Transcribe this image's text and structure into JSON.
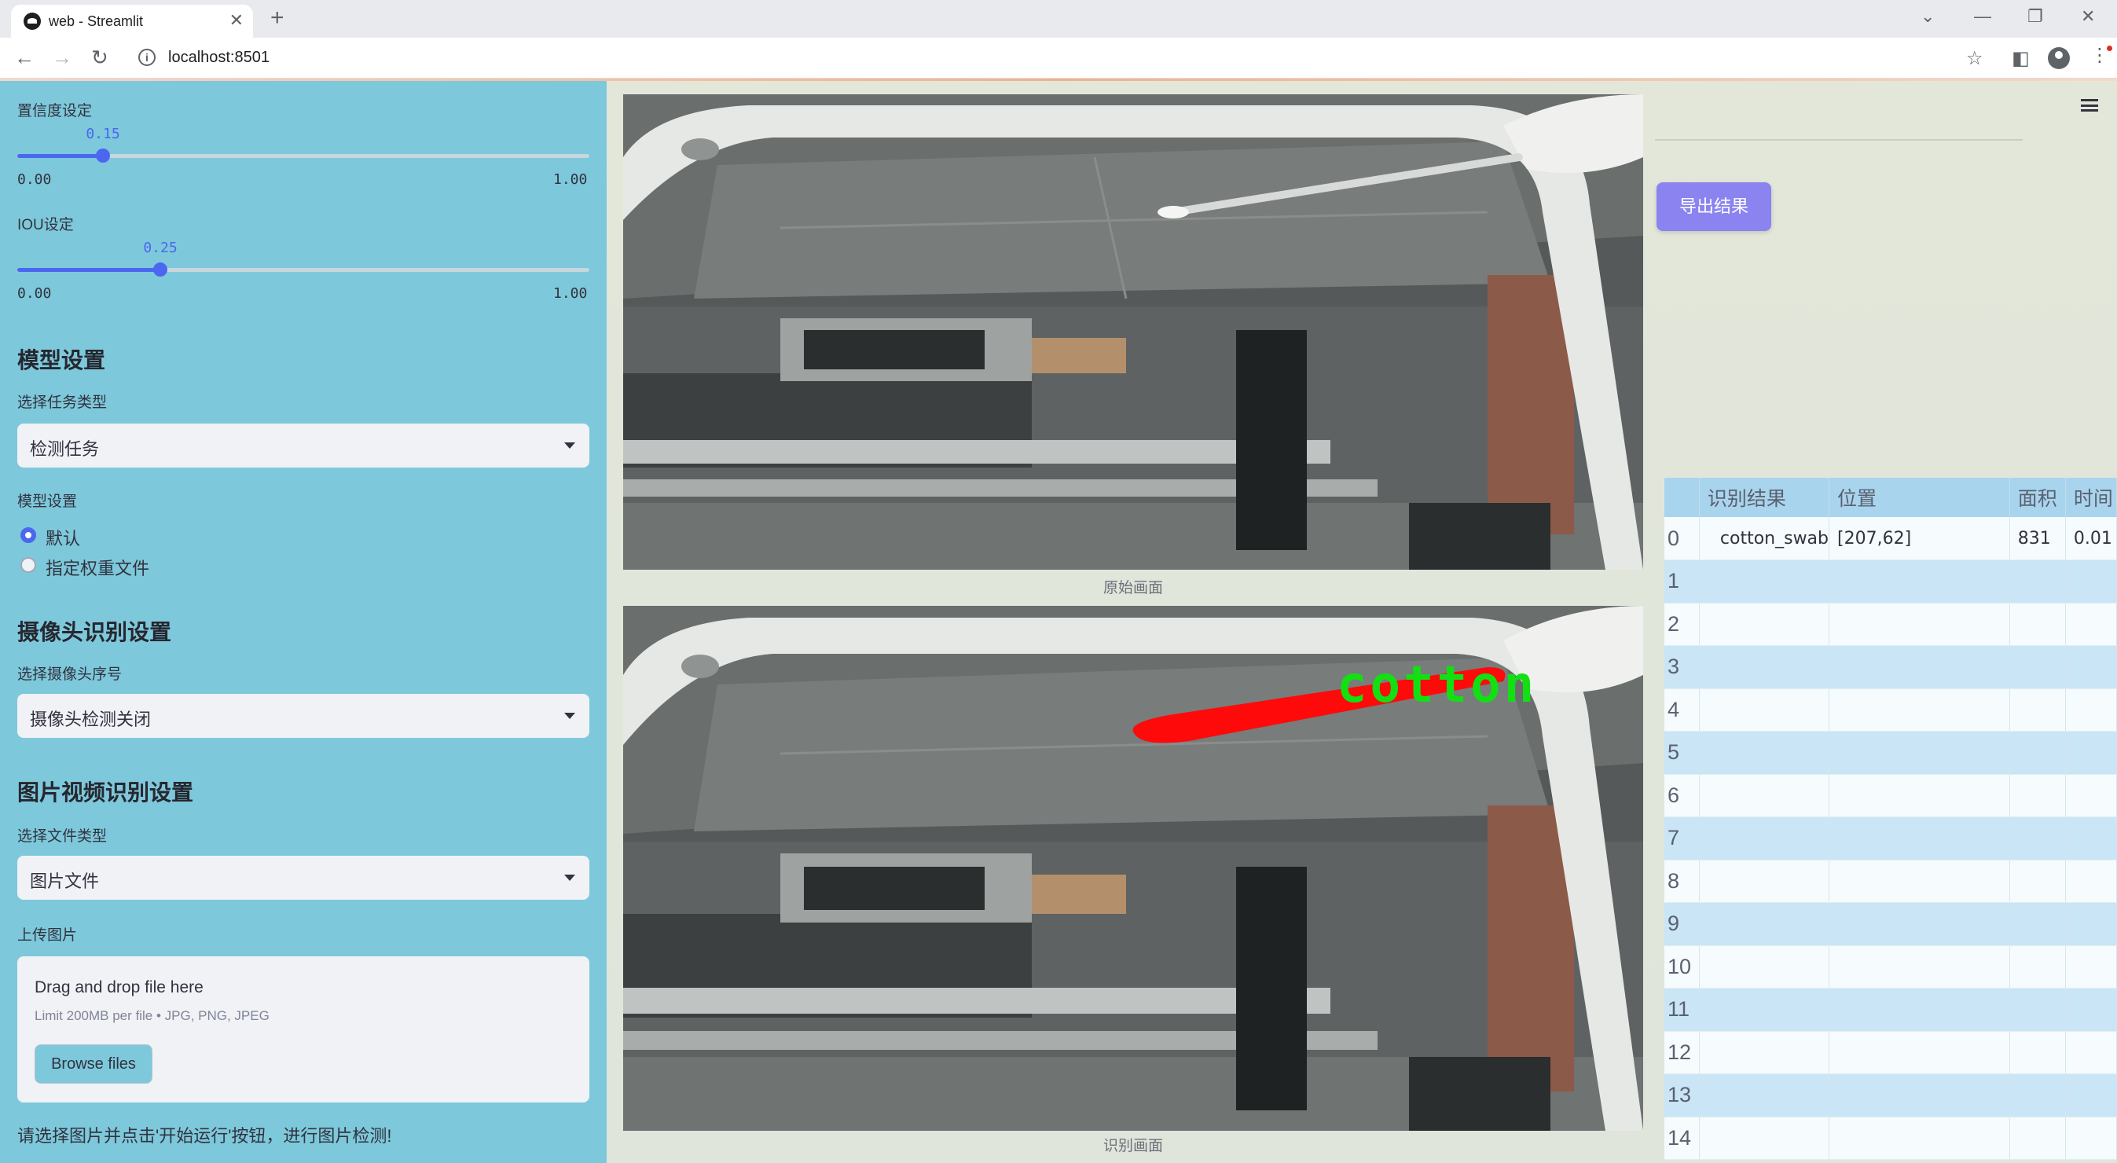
{
  "browser": {
    "tab_title": "web - Streamlit",
    "url": "localhost:8501"
  },
  "sidebar": {
    "confidence": {
      "label": "置信度设定",
      "value": "0.15",
      "min": "0.00",
      "max": "1.00",
      "fraction": 0.15
    },
    "iou": {
      "label": "IOU设定",
      "value": "0.25",
      "min": "0.00",
      "max": "1.00",
      "fraction": 0.25
    },
    "model_section": "模型设置",
    "task_type_label": "选择任务类型",
    "task_type_value": "检测任务",
    "model_label": "模型设置",
    "model_options": [
      "默认",
      "指定权重文件"
    ],
    "camera_section": "摄像头识别设置",
    "camera_label": "选择摄像头序号",
    "camera_value": "摄像头检测关闭",
    "media_section": "图片视频识别设置",
    "file_type_label": "选择文件类型",
    "file_type_value": "图片文件",
    "upload_label": "上传图片",
    "upload": {
      "title": "Drag and drop file here",
      "limit": "Limit 200MB per file • JPG, PNG, JPEG",
      "button": "Browse files"
    },
    "hint": "请选择图片并点击'开始运行'按钮，进行图片检测!"
  },
  "main": {
    "original_caption": "原始画面",
    "result_caption": "识别画面",
    "detection_label": "cotton",
    "export_button": "导出结果",
    "table": {
      "columns": [
        "",
        "识别结果",
        "位置",
        "面积",
        "时间"
      ],
      "rows": [
        [
          "0",
          "cotton_swab",
          "[207,62]",
          "831",
          "0.01"
        ],
        [
          "1",
          "",
          "",
          "",
          ""
        ],
        [
          "2",
          "",
          "",
          "",
          ""
        ],
        [
          "3",
          "",
          "",
          "",
          ""
        ],
        [
          "4",
          "",
          "",
          "",
          ""
        ],
        [
          "5",
          "",
          "",
          "",
          ""
        ],
        [
          "6",
          "",
          "",
          "",
          ""
        ],
        [
          "7",
          "",
          "",
          "",
          ""
        ],
        [
          "8",
          "",
          "",
          "",
          ""
        ],
        [
          "9",
          "",
          "",
          "",
          ""
        ],
        [
          "10",
          "",
          "",
          "",
          ""
        ],
        [
          "11",
          "",
          "",
          "",
          ""
        ],
        [
          "12",
          "",
          "",
          "",
          ""
        ],
        [
          "13",
          "",
          "",
          "",
          ""
        ],
        [
          "14",
          "",
          "",
          "",
          ""
        ]
      ]
    }
  },
  "colors": {
    "sidebar_bg": "#7ec8db",
    "accent": "#4b67f0",
    "export_button": "#8a83f0",
    "detection": "#ff0000",
    "detection_text": "#00e000",
    "table_header": "#a9d4ee"
  }
}
